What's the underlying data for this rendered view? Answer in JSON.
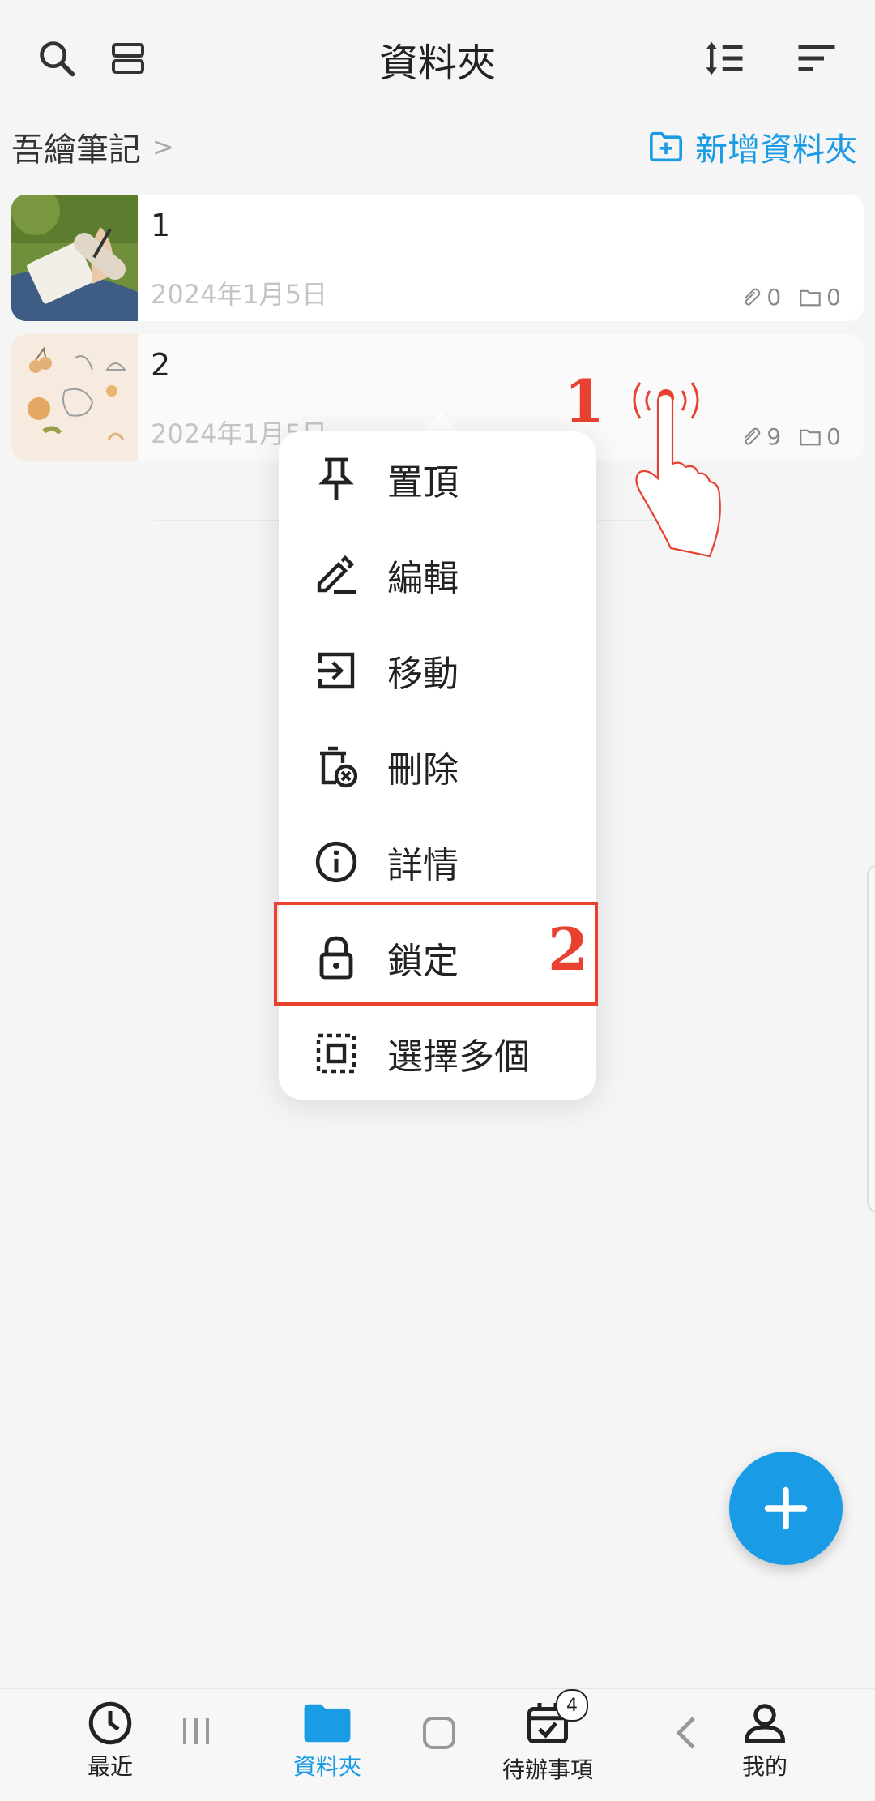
{
  "header": {
    "title": "資料夾"
  },
  "breadcrumb": {
    "root": "吾繪筆記",
    "separator": ">"
  },
  "new_folder": {
    "label": "新增資料夾"
  },
  "folders": [
    {
      "name": "1",
      "date": "2024年1月5日",
      "attachments": "0",
      "subfolders": "0"
    },
    {
      "name": "2",
      "date": "2024年1月5日",
      "attachments": "9",
      "subfolders": "0"
    }
  ],
  "context_menu": {
    "items": [
      {
        "label": "置頂",
        "icon": "pin-icon"
      },
      {
        "label": "編輯",
        "icon": "edit-icon"
      },
      {
        "label": "移動",
        "icon": "move-icon"
      },
      {
        "label": "刪除",
        "icon": "delete-icon"
      },
      {
        "label": "詳情",
        "icon": "info-icon"
      },
      {
        "label": "鎖定",
        "icon": "lock-icon"
      },
      {
        "label": "選擇多個",
        "icon": "select-multiple-icon"
      }
    ]
  },
  "annotations": {
    "step1": "1",
    "step2": "2"
  },
  "bottom_nav": {
    "items": [
      {
        "label": "最近",
        "icon": "clock-icon"
      },
      {
        "label": "資料夾",
        "icon": "folder-icon",
        "active": true
      },
      {
        "label": "待辦事項",
        "icon": "calendar-check-icon",
        "badge": "4"
      },
      {
        "label": "我的",
        "icon": "person-icon"
      }
    ]
  },
  "colors": {
    "accent": "#1a9be6",
    "annotation": "#e8412f",
    "background": "#f5f5f5"
  }
}
